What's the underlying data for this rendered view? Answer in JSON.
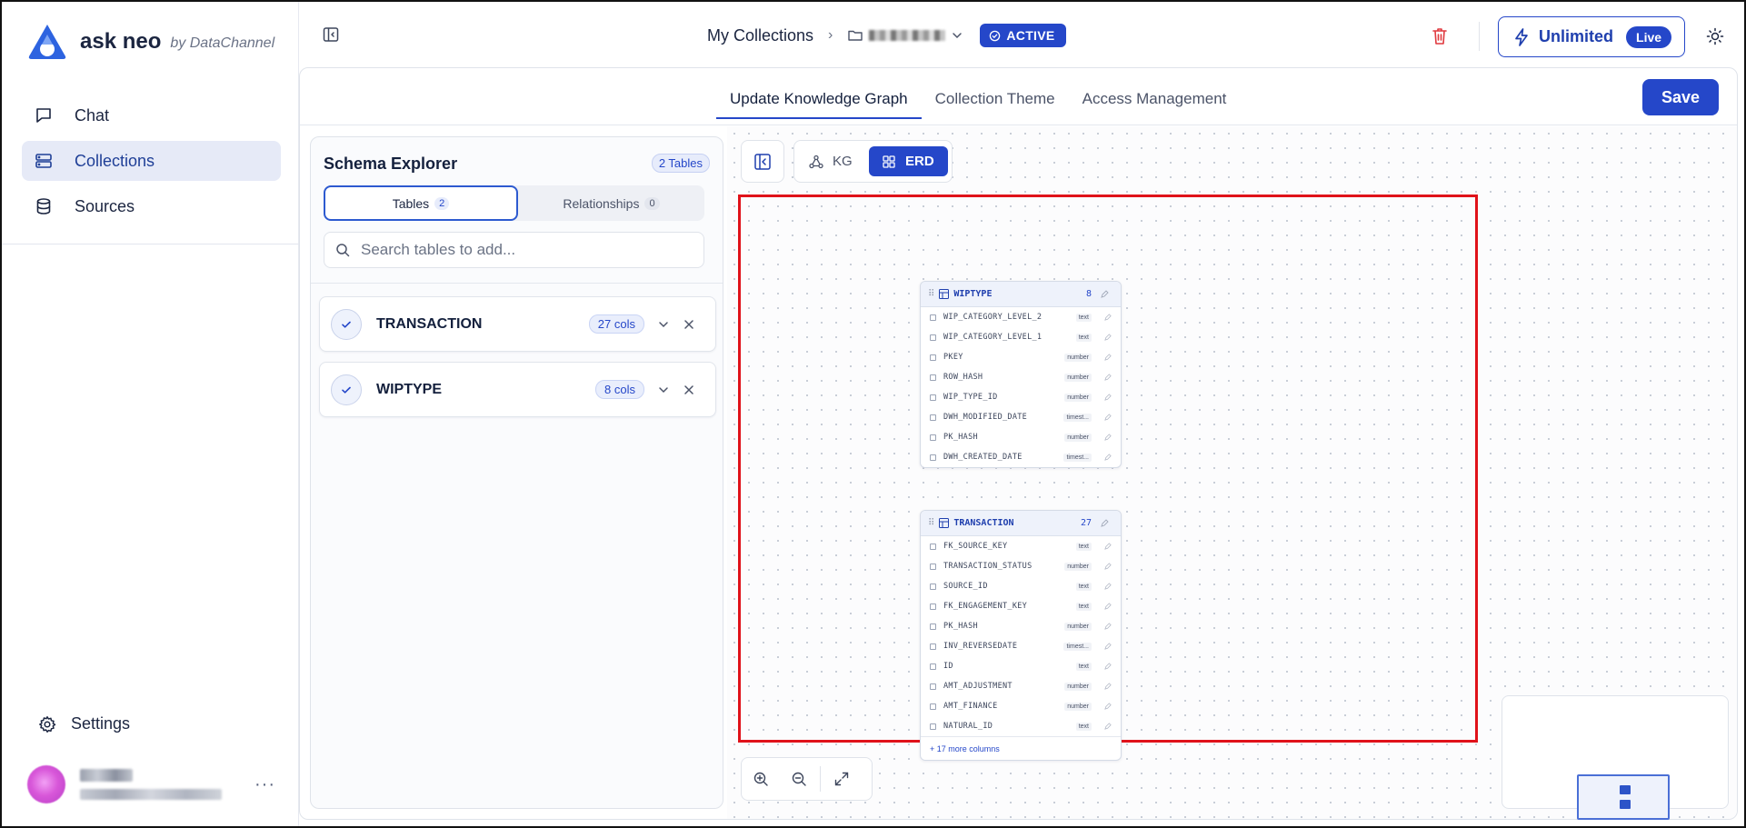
{
  "app": {
    "brand_name": "ask neo",
    "brand_by": "by DataChannel"
  },
  "sidebar": {
    "items": [
      {
        "label": "Chat",
        "icon": "chat-icon",
        "active": false
      },
      {
        "label": "Collections",
        "icon": "collections-icon",
        "active": true
      },
      {
        "label": "Sources",
        "icon": "database-icon",
        "active": false
      }
    ],
    "settings_label": "Settings",
    "more_label": "···"
  },
  "header": {
    "breadcrumb_root": "My Collections",
    "status_badge": "ACTIVE",
    "plan_label": "Unlimited",
    "plan_pill": "Live"
  },
  "tabs": [
    {
      "label": "Update Knowledge Graph",
      "active": true
    },
    {
      "label": "Collection Theme",
      "active": false
    },
    {
      "label": "Access Management",
      "active": false
    }
  ],
  "save_label": "Save",
  "schema": {
    "title": "Schema Explorer",
    "tables_badge": "2 Tables",
    "segments": [
      {
        "label": "Tables",
        "count": "2",
        "active": true
      },
      {
        "label": "Relationships",
        "count": "0",
        "active": false
      }
    ],
    "search_placeholder": "Search tables to add...",
    "selected_tables": [
      {
        "name": "TRANSACTION",
        "cols": "27 cols"
      },
      {
        "name": "WIPTYPE",
        "cols": "8 cols"
      }
    ]
  },
  "canvas": {
    "view_modes": [
      {
        "label": "KG",
        "active": false
      },
      {
        "label": "ERD",
        "active": true
      }
    ],
    "erd_tables": [
      {
        "name": "WIPTYPE",
        "count": "8",
        "columns": [
          {
            "name": "WIP_CATEGORY_LEVEL_2",
            "type": "text"
          },
          {
            "name": "WIP_CATEGORY_LEVEL_1",
            "type": "text"
          },
          {
            "name": "PKEY",
            "type": "number"
          },
          {
            "name": "ROW_HASH",
            "type": "number"
          },
          {
            "name": "WIP_TYPE_ID",
            "type": "number"
          },
          {
            "name": "DWH_MODIFIED_DATE",
            "type": "timest..."
          },
          {
            "name": "PK_HASH",
            "type": "number"
          },
          {
            "name": "DWH_CREATED_DATE",
            "type": "timest..."
          }
        ],
        "more": ""
      },
      {
        "name": "TRANSACTION",
        "count": "27",
        "columns": [
          {
            "name": "FK_SOURCE_KEY",
            "type": "text"
          },
          {
            "name": "TRANSACTION_STATUS",
            "type": "number"
          },
          {
            "name": "SOURCE_ID",
            "type": "text"
          },
          {
            "name": "FK_ENGAGEMENT_KEY",
            "type": "text"
          },
          {
            "name": "PK_HASH",
            "type": "number"
          },
          {
            "name": "INV_REVERSEDATE",
            "type": "timest..."
          },
          {
            "name": "ID",
            "type": "text"
          },
          {
            "name": "AMT_ADJUSTMENT",
            "type": "number"
          },
          {
            "name": "AMT_FINANCE",
            "type": "number"
          },
          {
            "name": "NATURAL_ID",
            "type": "text"
          }
        ],
        "more": "+ 17 more columns"
      }
    ]
  },
  "colors": {
    "accent": "#2547c9",
    "highlight_border": "#e0121a",
    "trash": "#e0393e"
  }
}
